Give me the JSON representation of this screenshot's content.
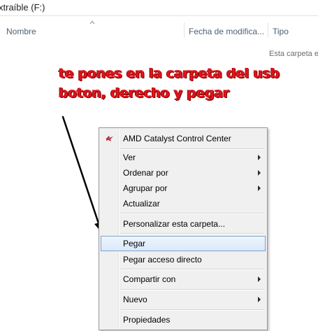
{
  "path": {
    "text": "xtraíble (F:)"
  },
  "columns": [
    {
      "label": "Nombre"
    },
    {
      "label": "Fecha de modifica..."
    },
    {
      "label": "Tipo"
    }
  ],
  "empty_message": "Esta carpeta e",
  "annotation": {
    "line1": "te pones en la carpeta del usb",
    "line2": "boton, derecho y pegar",
    "color": "#e0141c"
  },
  "context_menu": {
    "items": [
      {
        "label": "AMD Catalyst Control Center",
        "icon": "amd-catalyst-icon"
      },
      {
        "label": "Ver",
        "submenu": true
      },
      {
        "label": "Ordenar por",
        "submenu": true
      },
      {
        "label": "Agrupar por",
        "submenu": true
      },
      {
        "label": "Actualizar"
      },
      {
        "label": "Personalizar esta carpeta..."
      },
      {
        "label": "Pegar",
        "highlighted": true
      },
      {
        "label": "Pegar acceso directo"
      },
      {
        "label": "Compartir con",
        "submenu": true
      },
      {
        "label": "Nuevo",
        "submenu": true
      },
      {
        "label": "Propiedades"
      }
    ],
    "highlight_color": "#7da2ce"
  }
}
